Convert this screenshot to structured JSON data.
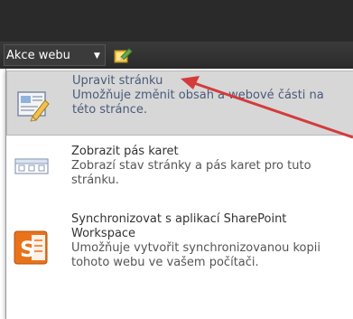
{
  "toolbar": {
    "site_actions_label": "Akce webu",
    "site_actions_chevron": "▼"
  },
  "menu": {
    "items": [
      {
        "title": "Upravit stránku",
        "description": "Umožňuje změnit obsah a webové části na této stránce.",
        "icon": "edit-page-icon",
        "state": "hover"
      },
      {
        "title": "Zobrazit pás karet",
        "description": "Zobrazí stav stránky a pás karet pro tuto stránku.",
        "icon": "ribbon-icon"
      },
      {
        "title": "Synchronizovat s aplikací SharePoint Workspace",
        "description": "Umožňuje vytvořit synchronizovanou kopii tohoto webu ve vašem počítači.",
        "icon": "sharepoint-workspace-icon"
      }
    ]
  },
  "colors": {
    "top_bar": "#2a2a2a",
    "hover_bg": "#d7d7d7",
    "annotation_arrow": "#d43b3b",
    "sharepoint_orange": "#e8731b"
  }
}
